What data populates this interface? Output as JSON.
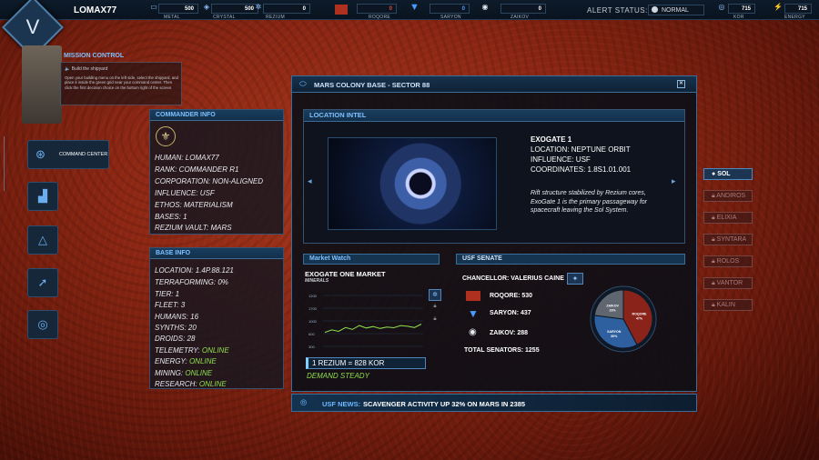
{
  "player": {
    "name": "LOMAX77"
  },
  "resources": [
    {
      "label": "METAL",
      "value": "500",
      "icon": "metal-icon"
    },
    {
      "label": "CRYSTAL",
      "value": "500",
      "icon": "crystal-icon"
    },
    {
      "label": "REZIUM",
      "value": "0",
      "icon": "rezium-icon"
    }
  ],
  "factions": [
    {
      "label": "ROQORE",
      "value": "0",
      "color": "#e04b3a"
    },
    {
      "label": "SARYON",
      "value": "0",
      "color": "#4a9bff"
    },
    {
      "label": "ZAIKOV",
      "value": "0",
      "color": "#dfe3ea"
    }
  ],
  "alert": {
    "label": "ALERT STATUS:",
    "value": "NORMAL"
  },
  "currency": [
    {
      "label": "KOR",
      "value": "715"
    },
    {
      "label": "ENERGY",
      "value": "715"
    }
  ],
  "mission": {
    "title": "MISSION CONTROL",
    "task": "Build the shipyard",
    "body": "Open your building menu on the left side, select the shipyard, and place it inside the green grid near your command center. Then click the first decision choice on the bottom right of the screen."
  },
  "sidebar": {
    "command_center": "COMMAND CENTER"
  },
  "commander": {
    "header": "COMMANDER INFO",
    "lines": [
      "HUMAN: LOMAX77",
      "RANK: COMMANDER R1",
      "CORPORATION: NON-ALIGNED",
      "INFLUENCE: USF",
      "ETHOS: MATERIALISM",
      "BASES: 1",
      "REZIUM VAULT: MARS"
    ]
  },
  "base": {
    "header": "BASE INFO",
    "lines": [
      "LOCATION: 1.4P.88.121",
      "TERRAFORMING: 0%",
      "TIER: 1",
      "FLEET: 3",
      "HUMANS: 16",
      "SYNTHS: 20",
      "DROIDS: 28"
    ],
    "status": [
      {
        "k": "TELEMETRY:",
        "v": "ONLINE"
      },
      {
        "k": "ENERGY:",
        "v": "ONLINE"
      },
      {
        "k": "MINING:",
        "v": "ONLINE"
      },
      {
        "k": "RESEARCH:",
        "v": "ONLINE"
      }
    ]
  },
  "window": {
    "title": "MARS COLONY BASE - SECTOR 88"
  },
  "intel": {
    "header": "LOCATION INTEL",
    "name": "EXOGATE 1",
    "location": "LOCATION: NEPTUNE ORBIT",
    "influence": "INFLUENCE: USF",
    "coords": "COORDINATES: 1.8S1.01.001",
    "desc": "Rift structure stabilized by Rezium cores, ExoGate 1 is the primary passageway for spacecraft leaving the Sol System."
  },
  "market": {
    "header": "Market Watch",
    "title": "EXOGATE ONE MARKET",
    "subtitle": "MINERALS",
    "yticks": [
      "1200",
      "1700",
      "1000",
      "600",
      "300"
    ],
    "rate": "1 REZIUM = 828 KOR",
    "demand": "DEMAND STEADY"
  },
  "chart_data": {
    "type": "line",
    "title": "EXOGATE ONE MARKET",
    "values": [
      420,
      470,
      440,
      520,
      480,
      560,
      510,
      540,
      500,
      530,
      515,
      560,
      545,
      520,
      590
    ]
  },
  "senate": {
    "header": "USF SENATE",
    "chancellor": "CHANCELLOR: VALERIUS CAINE",
    "members": [
      {
        "label": "ROQORE: 530",
        "color": "#c23a2a"
      },
      {
        "label": "SARYON: 437",
        "color": "#3f7ed8"
      },
      {
        "label": "ZAIKOV: 288",
        "color": "#e6e9ee"
      }
    ],
    "total": "TOTAL SENATORS: 1255",
    "pie": [
      {
        "name": "ROQORE",
        "pct": "47%",
        "v": 530
      },
      {
        "name": "SARYON",
        "pct": "30%",
        "v": 437
      },
      {
        "name": "ZAIKOV",
        "pct": "23%",
        "v": 288
      }
    ]
  },
  "news": {
    "label": "USF NEWS:",
    "text": "SCAVENGER ACTIVITY UP 32% ON MARS IN 2385"
  },
  "systems": [
    "SOL",
    "ANDIROS",
    "ELIXIA",
    "SYNTARA",
    "ROLOS",
    "VANTOR",
    "KALIN"
  ]
}
